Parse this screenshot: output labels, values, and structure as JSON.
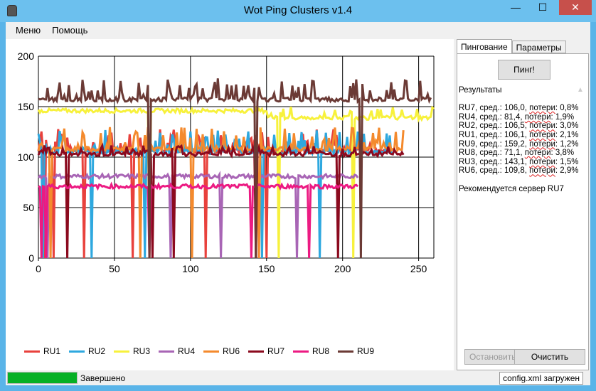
{
  "window": {
    "title": "Wot Ping Clusters v1.4",
    "minimize": "—",
    "maximize": "☐",
    "close": "✕"
  },
  "menu": [
    "Меню",
    "Помощь"
  ],
  "tabs": [
    "Пингование",
    "Параметры"
  ],
  "ping_button": "Пинг!",
  "results": {
    "header": "Результаты",
    "lines": [
      [
        "RU7, сред.: 106,0, ",
        "потери",
        ": 0,8%"
      ],
      [
        "RU4, сред.: 81,4, ",
        "потери",
        ": 1,9%"
      ],
      [
        "RU2, сред.: 106,5, ",
        "потери",
        ": 3,0%"
      ],
      [
        "RU1, сред.: 106,1, ",
        "потери",
        ": 2,1%"
      ],
      [
        "RU9, сред.: 159,2, ",
        "потери",
        ": 1,2%"
      ],
      [
        "RU8, сред.: 71,1, ",
        "потери",
        ": 3,8%"
      ],
      [
        "RU3, сред.: 143,1, ",
        "потери",
        ": 1,5%"
      ],
      [
        "RU6, сред.: 109,8, ",
        "потери",
        ": 2,9%"
      ]
    ],
    "recommendation": "Рекомендуется сервер RU7"
  },
  "stop_button": "Остановить",
  "clear_button": "Очистить",
  "status": {
    "text": "Завершено",
    "progress": 1.0,
    "config": "config.xml загружен"
  },
  "chart_data": {
    "type": "line",
    "xlim": [
      0,
      260
    ],
    "ylim": [
      0,
      200
    ],
    "xticks": [
      0,
      50,
      100,
      150,
      200,
      250
    ],
    "yticks": [
      0,
      50,
      100,
      150,
      200
    ],
    "grid": true,
    "legend": "bottom",
    "series": [
      {
        "name": "RU1",
        "color": "#e8413c",
        "mean": 106,
        "spike": 128,
        "length": 228,
        "drops": [
          4,
          10,
          30,
          62,
          110,
          150
        ]
      },
      {
        "name": "RU2",
        "color": "#2ea8df",
        "mean": 105,
        "spike": 128,
        "length": 232,
        "drops": [
          3,
          35,
          70,
          147,
          185
        ]
      },
      {
        "name": "RU3",
        "color": "#f7f13c",
        "mean": 146,
        "mean2": 139,
        "switch": 150,
        "spike": 150,
        "length": 260,
        "drops": [
          73,
          158,
          207
        ]
      },
      {
        "name": "RU4",
        "color": "#a865b5",
        "mean": 81,
        "spike": 81,
        "length": 210,
        "drops": [
          6,
          87,
          120,
          170
        ]
      },
      {
        "name": "RU6",
        "color": "#f48a2d",
        "mean": 108,
        "spike": 130,
        "length": 240,
        "drops": [
          8,
          67,
          101,
          145
        ]
      },
      {
        "name": "RU7",
        "color": "#8b0a1e",
        "mean": 103,
        "spike": 112,
        "length": 240,
        "drops": [
          19,
          75,
          89,
          143,
          197
        ]
      },
      {
        "name": "RU8",
        "color": "#ec1a82",
        "mean": 71,
        "spike": 71,
        "length": 210,
        "drops": [
          2,
          5,
          73,
          140,
          178
        ]
      },
      {
        "name": "RU9",
        "color": "#6b3a35",
        "mean": 157,
        "spike": 178,
        "length": 258,
        "drops": [
          73,
          143,
          212
        ]
      }
    ]
  }
}
